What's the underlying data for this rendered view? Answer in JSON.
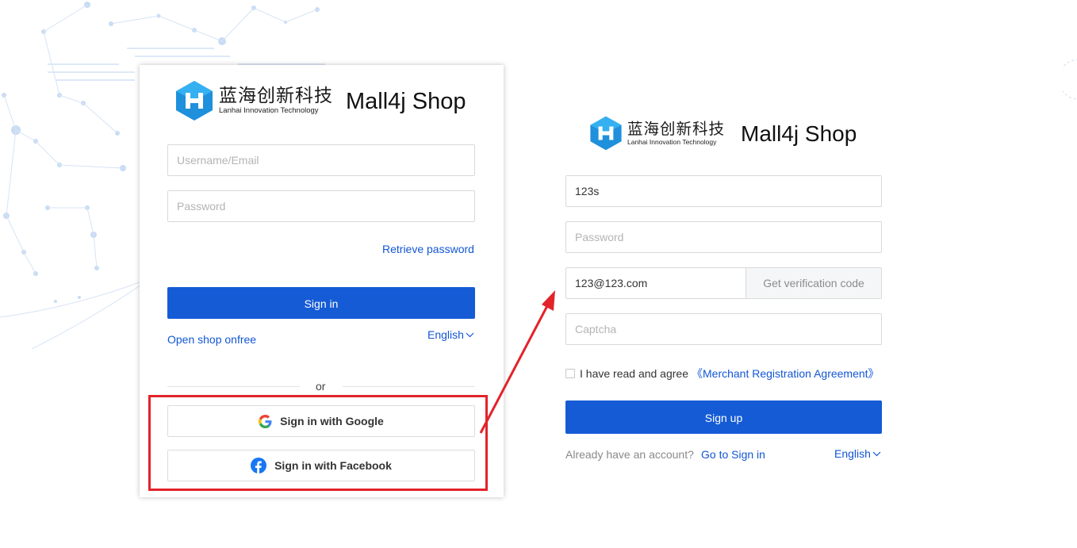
{
  "login": {
    "brand": {
      "logo_cn": "蓝海创新科技",
      "logo_en": "Lanhai Innovation Technology",
      "shop_name": "Mall4j Shop"
    },
    "username_placeholder": "Username/Email",
    "password_placeholder": "Password",
    "retrieve_password": "Retrieve password",
    "sign_in": "Sign in",
    "open_shop": "Open shop onfree",
    "language": "English",
    "or": "or",
    "google_button": "Sign in with Google",
    "facebook_button": "Sign in with Facebook"
  },
  "register": {
    "brand": {
      "logo_cn": "蓝海创新科技",
      "logo_en": "Lanhai Innovation Technology",
      "shop_name": "Mall4j Shop"
    },
    "username_value": "123s",
    "password_placeholder": "Password",
    "email_value": "123@123.com",
    "get_code": "Get verification code",
    "captcha_placeholder": "Captcha",
    "agree_text": "I have read and agree",
    "agreement_link": "《Merchant Registration Agreement》",
    "sign_up": "Sign up",
    "already_account": "Already have an account?",
    "go_sign_in": "Go to Sign in",
    "language": "English"
  },
  "colors": {
    "primary": "#155bd5",
    "link": "#1256d6",
    "highlight": "#e2232a"
  },
  "icons": [
    "logo-icon",
    "chevron-down-icon",
    "google-icon",
    "facebook-icon"
  ]
}
